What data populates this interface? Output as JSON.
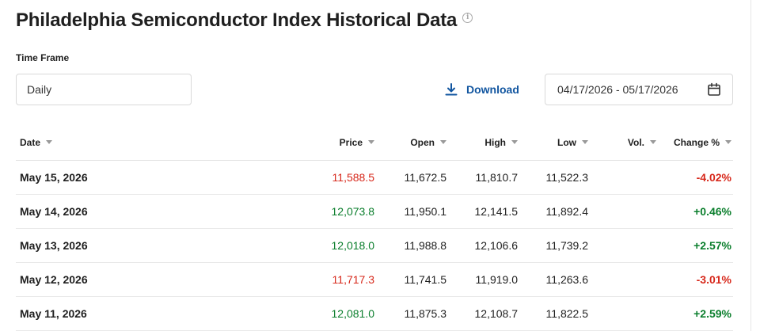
{
  "header": {
    "title": "Philadelphia Semiconductor Index Historical Data",
    "info_glyph": "i"
  },
  "filters": {
    "time_frame_label": "Time Frame",
    "time_frame_value": "Daily",
    "download_label": "Download",
    "date_range": "04/17/2026 - 05/17/2026"
  },
  "colors": {
    "positive": "#0a7e2c",
    "negative": "#d7281b",
    "link": "#1256a0"
  },
  "table": {
    "columns": {
      "date": "Date",
      "price": "Price",
      "open": "Open",
      "high": "High",
      "low": "Low",
      "vol": "Vol.",
      "change": "Change %"
    },
    "rows": [
      {
        "date": "May 15, 2026",
        "price": "11,588.5",
        "open": "11,672.5",
        "high": "11,810.7",
        "low": "11,522.3",
        "vol": "",
        "change": "-4.02%",
        "direction": "down"
      },
      {
        "date": "May 14, 2026",
        "price": "12,073.8",
        "open": "11,950.1",
        "high": "12,141.5",
        "low": "11,892.4",
        "vol": "",
        "change": "+0.46%",
        "direction": "up"
      },
      {
        "date": "May 13, 2026",
        "price": "12,018.0",
        "open": "11,988.8",
        "high": "12,106.6",
        "low": "11,739.2",
        "vol": "",
        "change": "+2.57%",
        "direction": "up"
      },
      {
        "date": "May 12, 2026",
        "price": "11,717.3",
        "open": "11,741.5",
        "high": "11,919.0",
        "low": "11,263.6",
        "vol": "",
        "change": "-3.01%",
        "direction": "down"
      },
      {
        "date": "May 11, 2026",
        "price": "12,081.0",
        "open": "11,875.3",
        "high": "12,108.7",
        "low": "11,822.5",
        "vol": "",
        "change": "+2.59%",
        "direction": "up"
      }
    ]
  }
}
